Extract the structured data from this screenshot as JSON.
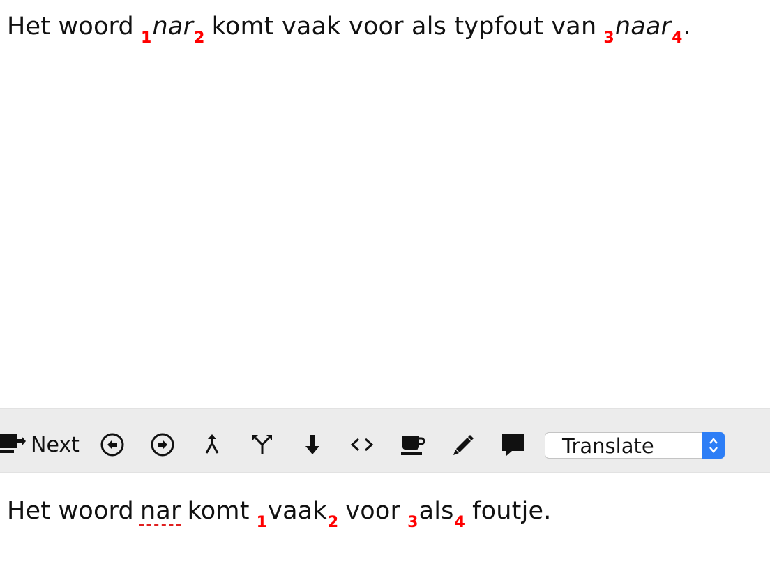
{
  "source": {
    "pre": "Het woord",
    "tag1": "1",
    "word1": "nar",
    "tag2": "2",
    "mid": "komt vaak voor als typfout van",
    "tag3": "3",
    "word2": "naar",
    "tag4": "4",
    "end": "."
  },
  "toolbar": {
    "next_label": "Next",
    "icons": [
      "previous-circle-icon",
      "next-circle-icon",
      "merge-icon",
      "split-icon",
      "down-arrow-icon",
      "code-brackets-icon",
      "coffee-cup-icon",
      "pencil-icon",
      "comment-bubble-icon"
    ],
    "mode_select": {
      "value": "Translate"
    }
  },
  "target": {
    "pre": "Het woord",
    "misspelled_word": "nar",
    "mid1": "komt",
    "tag1": "1",
    "word1": "vaak",
    "tag2": "2",
    "mid2": "voor",
    "tag3": "3",
    "word2": "als",
    "tag4": "4",
    "end": "foutje."
  },
  "colors": {
    "tag": "#ff0000",
    "toolbar_bg": "#ececec",
    "select_accent": "#2d7ef6",
    "spellcheck_underline": "#e02020"
  }
}
